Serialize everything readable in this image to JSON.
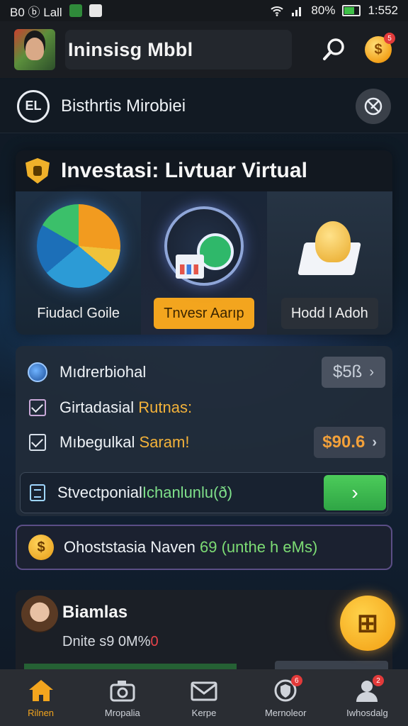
{
  "status_bar": {
    "left": "B0 ⓑ Lall",
    "battery_text": "80%",
    "time": "1:552"
  },
  "app_header": {
    "title": "Ininsisg Mbbl",
    "notification_count": "5"
  },
  "sub_header": {
    "logo_text": "EL",
    "name": "Bisthrtis Mirobiei"
  },
  "invest": {
    "title": "Investasi: Livtuar Virtual",
    "options": [
      {
        "label": "Fiudacl Goile"
      },
      {
        "label": "Tnvesr Aarıp"
      },
      {
        "label": "Hodd l Adoh"
      }
    ]
  },
  "account": {
    "rows": [
      {
        "label": "Mıdrerbiohal",
        "value": "$5ß",
        "chevron": "›"
      },
      {
        "label_main": "Girtadasial ",
        "label_highlight": "Rutnas:"
      },
      {
        "label_main": "Mıbegulkal ",
        "label_highlight": "Saram!",
        "value": "$90.6",
        "chevron": "›"
      }
    ],
    "action": {
      "label_main": "Stvectponial",
      "label_highlight": "Ichanlunlu(ð)",
      "button_icon": "›"
    }
  },
  "bonus": {
    "icon_symbol": "$",
    "label_main": "Ohoststasia Naven ",
    "label_highlight": "69 (unthe h eMs)"
  },
  "profile": {
    "name": "Biamlas",
    "sub_main": "Dnite s9 0M%",
    "sub_red": "0",
    "fab_symbol": "⊞"
  },
  "nav": [
    {
      "label": "Rilnen",
      "icon": "home-icon"
    },
    {
      "label": "Mropalia",
      "icon": "camera-icon"
    },
    {
      "label": "Kerpe",
      "icon": "mail-icon"
    },
    {
      "label": "Mernoleor",
      "icon": "shield-icon",
      "badge": "6"
    },
    {
      "label": "Iwhosdalg",
      "icon": "user-icon",
      "badge": "2"
    }
  ],
  "colors": {
    "accent": "#f3a51e",
    "success": "#3fbf4f",
    "badge": "#e23a3a"
  }
}
